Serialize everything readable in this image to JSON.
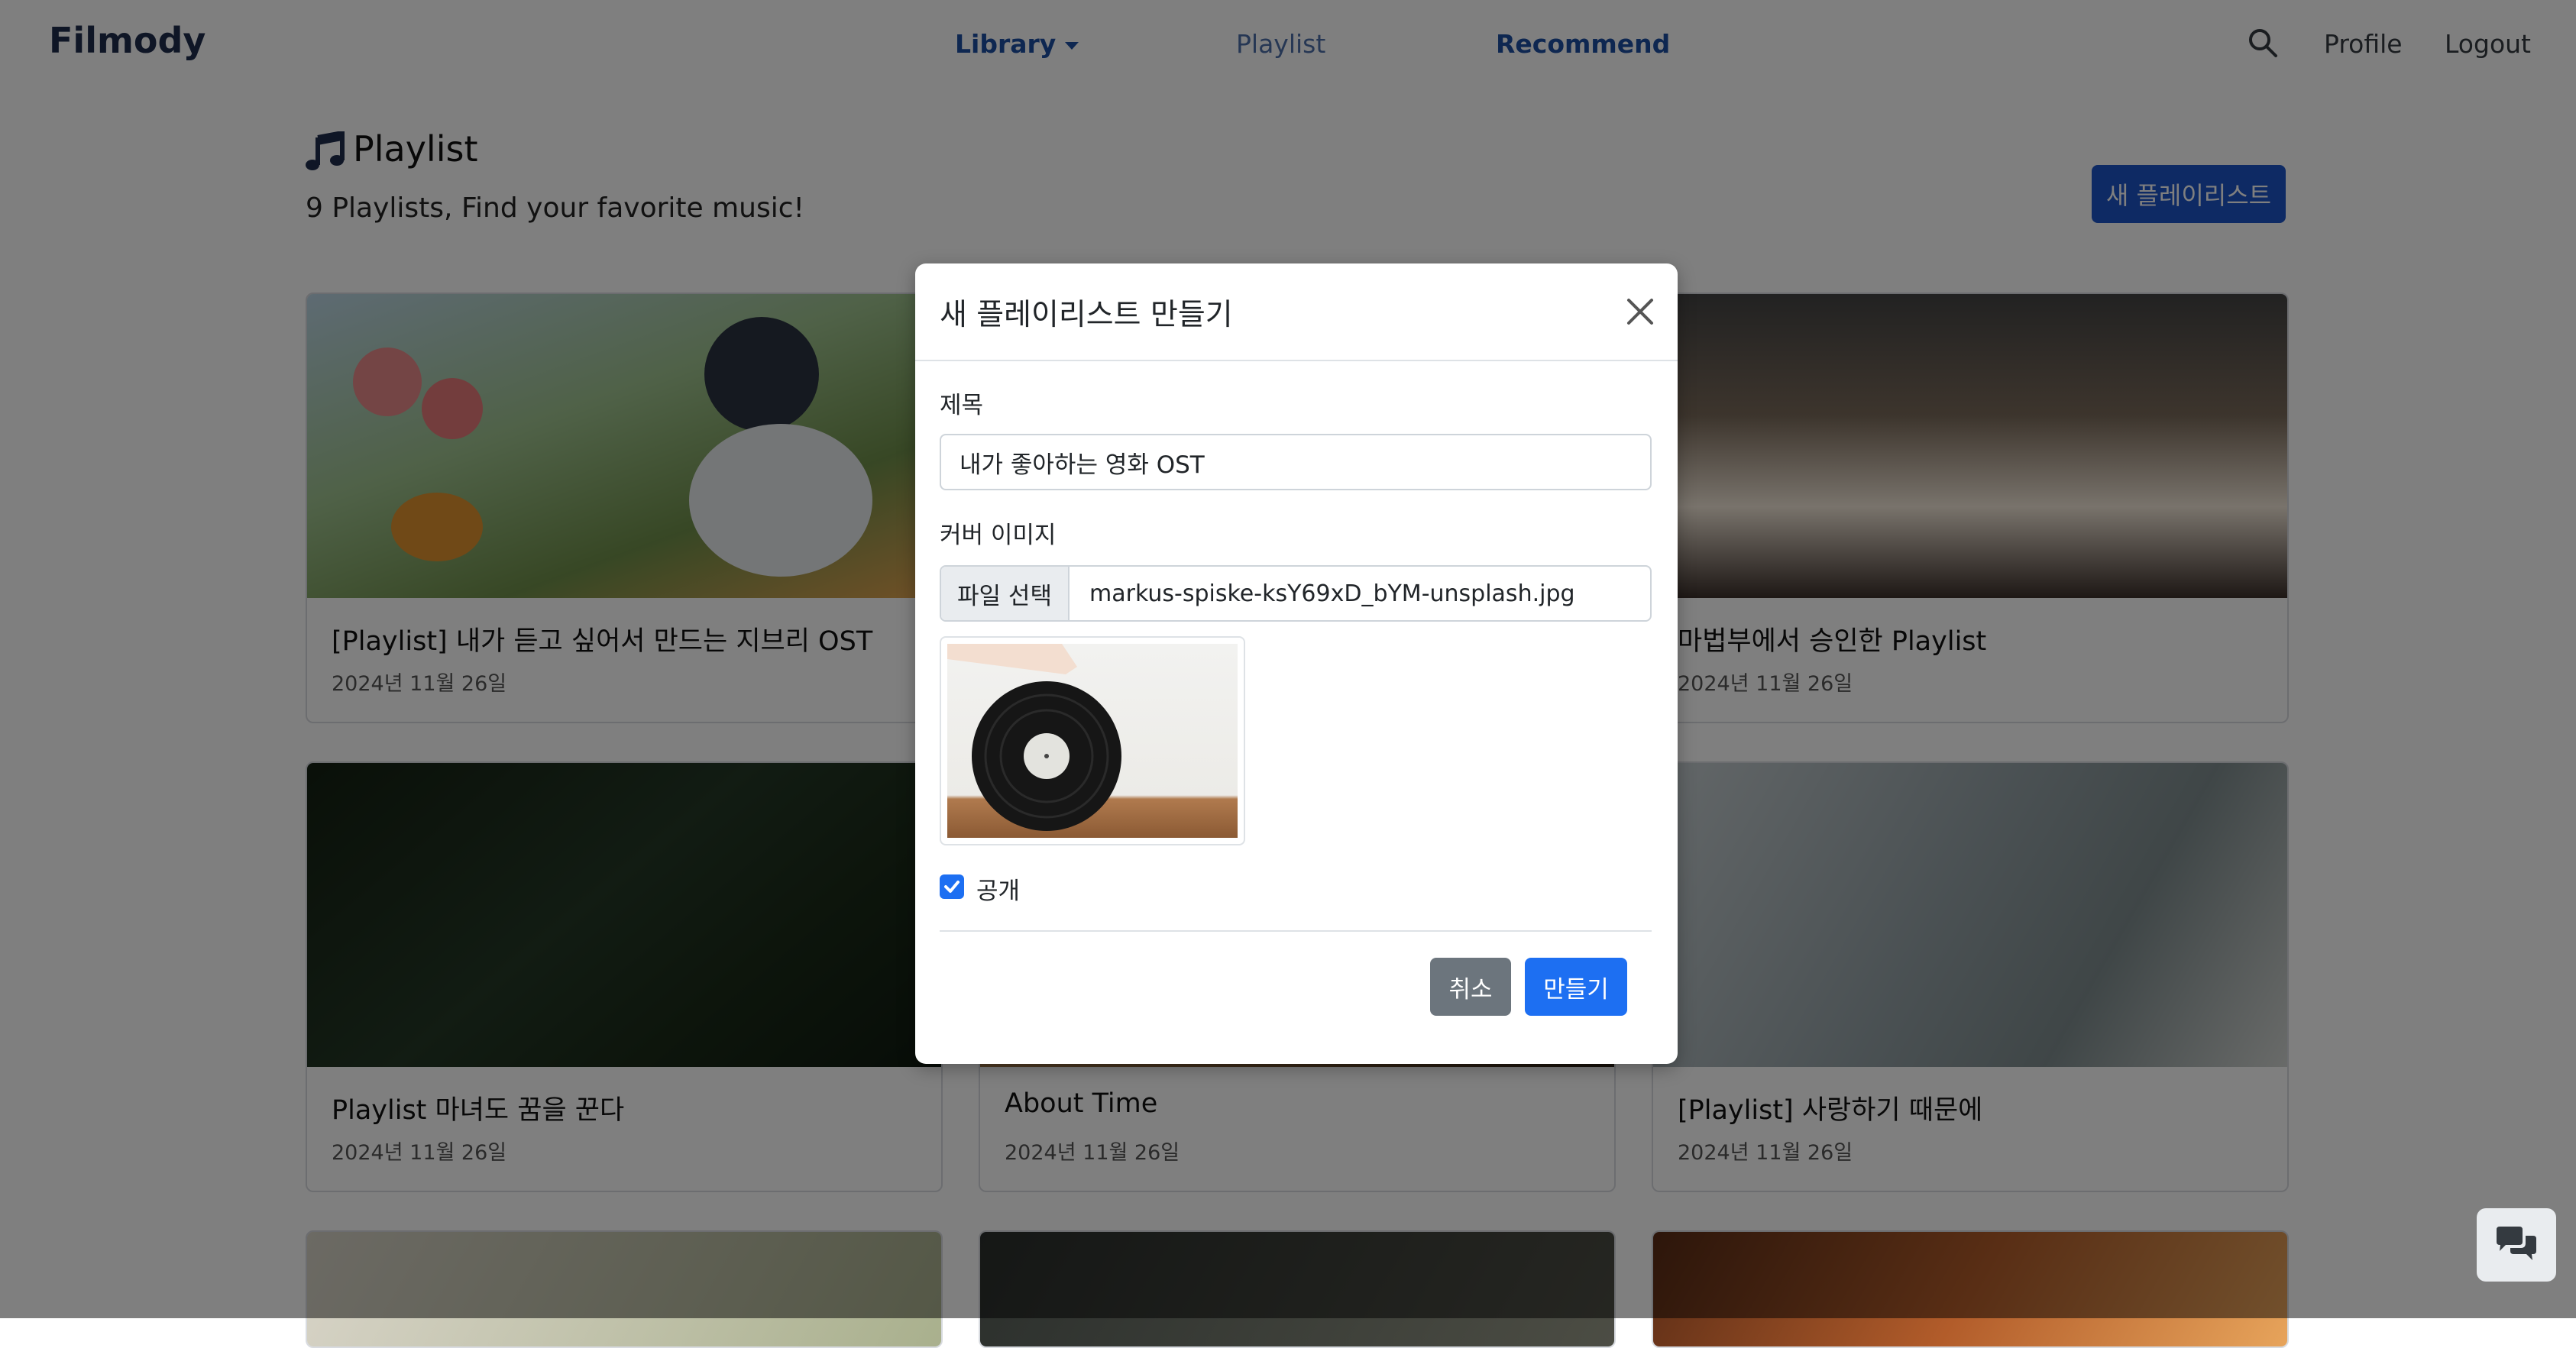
{
  "navbar": {
    "brand": "Filmody",
    "library": "Library",
    "playlist": "Playlist",
    "recommend": "Recommend",
    "profile": "Profile",
    "logout": "Logout"
  },
  "header": {
    "title": "Playlist",
    "subtitle": "9 Playlists, Find your favorite music!",
    "new_button": "새 플레이리스트"
  },
  "cards": [
    {
      "title": "[Playlist] 내가 듣고 싶어서 만드는 지브리 OST",
      "date": "2024년 11월 26일"
    },
    {
      "title": "마법부에서 승인한 Playlist",
      "date": "2024년 11월 26일"
    },
    {
      "title": "Playlist 마녀도 꿈을 꾼다",
      "date": "2024년 11월 26일"
    },
    {
      "title": "About Time",
      "date": "2024년 11월 26일"
    },
    {
      "title": "[Playlist] 사랑하기 때문에",
      "date": "2024년 11월 26일"
    }
  ],
  "modal": {
    "title": "새 플레이리스트 만들기",
    "title_label": "제목",
    "title_value": "내가 좋아하는 영화 OST",
    "cover_label": "커버 이미지",
    "file_button": "파일 선택",
    "file_name": "markus-spiske-ksY69xD_bYM-unsplash.jpg",
    "public_label": "공개",
    "public_checked": true,
    "cancel": "취소",
    "create": "만들기"
  },
  "colors": {
    "primary": "#1d6ff2",
    "nav_active": "#1d4fa3",
    "secondary": "#6c757d"
  }
}
